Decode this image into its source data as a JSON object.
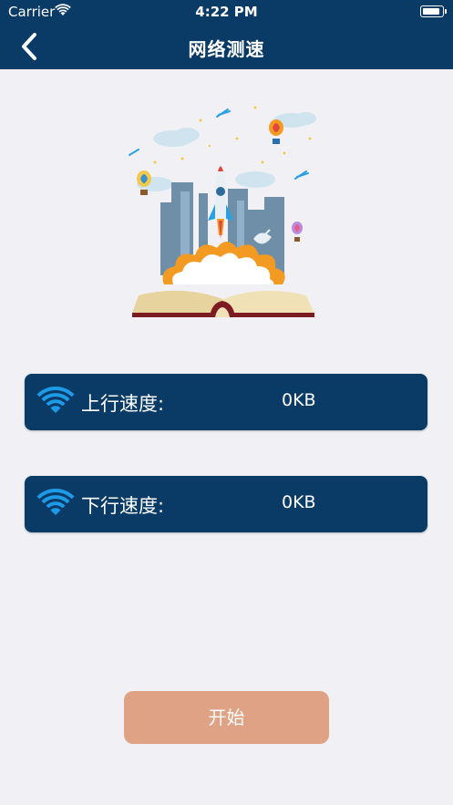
{
  "status_bar": {
    "carrier": "Carrier",
    "time": "4:22 PM"
  },
  "nav": {
    "title": "网络测速"
  },
  "upload": {
    "label": "上行速度:",
    "value": "0KB"
  },
  "download": {
    "label": "下行速度:",
    "value": "0KB"
  },
  "start_button": {
    "label": "开始"
  },
  "icons": {
    "back": "chevron-left-icon",
    "wifi": "wifi-icon",
    "illustration": "rocket-book-illustration"
  },
  "colors": {
    "navbar": "#0a3a66",
    "card": "#0a3a66",
    "wifi_icon": "#1e9be8",
    "start_button": "#e0a285",
    "background": "#f1f1f5"
  }
}
